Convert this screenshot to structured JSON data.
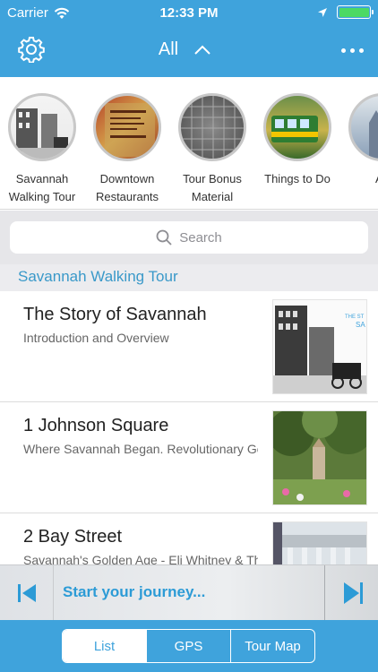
{
  "status": {
    "carrier": "Carrier",
    "time": "12:33 PM",
    "battery_level": 1.0
  },
  "nav": {
    "title": "All"
  },
  "categories": [
    {
      "label": "Savannah Walking Tour"
    },
    {
      "label": "Downtown Restaurants"
    },
    {
      "label": "Tour Bonus Material"
    },
    {
      "label": "Things to Do"
    },
    {
      "label": "Ab"
    }
  ],
  "search": {
    "placeholder": "Search"
  },
  "section": {
    "title": "Savannah Walking Tour"
  },
  "items": [
    {
      "title": "The Story of Savannah",
      "subtitle": "Introduction and Overview"
    },
    {
      "title": "1 Johnson Square",
      "subtitle": "Where Savannah Began.  Revolutionary Gen"
    },
    {
      "title": "2 Bay Street",
      "subtitle": "Savannah's Golden Age - Eli Whitney & The C"
    }
  ],
  "player": {
    "text": "Start your journey..."
  },
  "tabs": [
    {
      "label": "List",
      "active": true
    },
    {
      "label": "GPS",
      "active": false
    },
    {
      "label": "Tour Map",
      "active": false
    }
  ],
  "colors": {
    "accent": "#3fa3dc",
    "link": "#2c9bd6",
    "battery": "#4cd964"
  }
}
